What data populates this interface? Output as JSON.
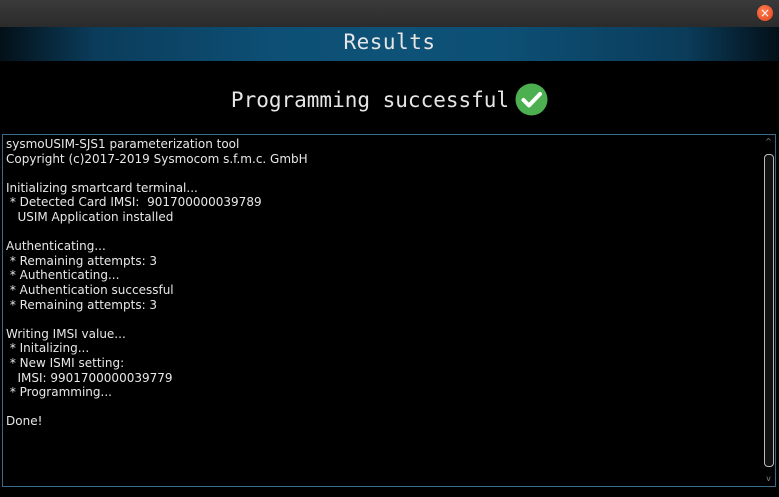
{
  "window": {
    "close_glyph": "×"
  },
  "header": {
    "title": "Results"
  },
  "status": {
    "message": "Programming successful",
    "success_color": "#4caf50"
  },
  "log": {
    "lines": [
      "sysmoUSIM-SJS1 parameterization tool",
      "Copyright (c)2017-2019 Sysmocom s.f.m.c. GmbH",
      "",
      "Initializing smartcard terminal...",
      " * Detected Card IMSI:  901700000039789",
      "   USIM Application installed",
      "",
      "Authenticating...",
      " * Remaining attempts: 3",
      " * Authenticating...",
      " * Authentication successful",
      " * Remaining attempts: 3",
      "",
      "Writing IMSI value...",
      " * Initalizing...",
      " * New ISMI setting:",
      "   IMSI: 9901700000039779",
      " * Programming...",
      "",
      "Done!"
    ]
  },
  "scrollbar": {
    "up_glyph": "^",
    "down_glyph": "v"
  }
}
